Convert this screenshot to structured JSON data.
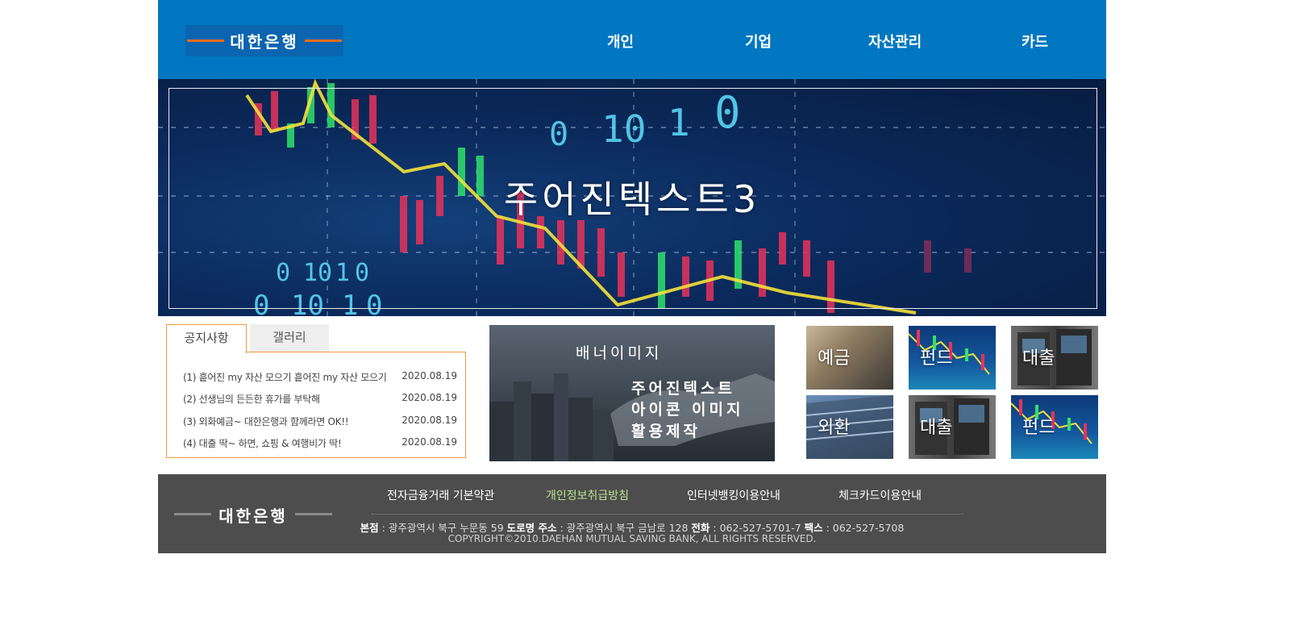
{
  "header": {
    "logo_text": "대한은행",
    "nav": [
      "개인",
      "기업",
      "자산관리",
      "카드"
    ]
  },
  "hero": {
    "title": "주어진텍스트3",
    "digits": [
      "0",
      "10",
      "1",
      "0",
      "0",
      "10",
      "1",
      "0",
      "0",
      "10",
      "1",
      "0"
    ]
  },
  "board": {
    "tabs": [
      "공지사항",
      "갤러리"
    ],
    "notices": [
      {
        "title": "(1) 흩어진 my 자산 모으기 흩어진 my 자산 모으기",
        "date": "2020.08.19"
      },
      {
        "title": "(2) 선생님의 든든한 휴가를 부탁해",
        "date": "2020.08.19"
      },
      {
        "title": "(3) 외화예금~ 대한은행과 함께라면 OK!!",
        "date": "2020.08.19"
      },
      {
        "title": "(4) 대출 딱~ 하면, 쇼핑 & 여행비가 딱!",
        "date": "2020.08.19"
      }
    ]
  },
  "banner": {
    "title": "배너이미지",
    "lines": [
      "주어진텍스트",
      "아이콘 이미지",
      "활용제작"
    ]
  },
  "tiles": [
    "예금",
    "펀드",
    "대출",
    "외환",
    "대출",
    "펀드"
  ],
  "footer": {
    "logo_text": "대한은행",
    "links": [
      "전자금융거래 기본약관",
      "개인정보취급방침",
      "인터넷뱅킹이용안내",
      "체크카드이용안내"
    ],
    "addr": {
      "hq_label": "본점",
      "hq": " : 광주광역시 북구 누문동 59 ",
      "road_label": "도로명 주소",
      "road": " : 광주광역시 북구 금남로 128 ",
      "tel_label": "전화",
      "tel": " : 062-527-5701-7 ",
      "fax_label": "팩스",
      "fax": " : 062-527-5708"
    },
    "copyright": "COPYRIGHT©2010.DAEHAN MUTUAL SAVING BANK, ALL RIGHTS RESERVED."
  },
  "colors": {
    "header_bg": "#0077c0",
    "accent_orange": "#e36c1d",
    "board_border": "#f19a3d",
    "footer_bg": "#4d4d4d",
    "footer_highlight": "#b9e38f"
  }
}
